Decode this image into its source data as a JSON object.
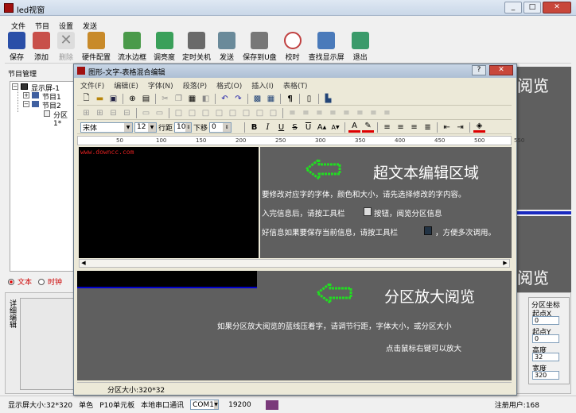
{
  "app": {
    "title": "led视窗"
  },
  "menu": [
    "文件",
    "节目",
    "设置",
    "发送"
  ],
  "toolbar": [
    {
      "label": "保存",
      "icon": "save-icon",
      "color": "#2a4fa8"
    },
    {
      "label": "添加",
      "icon": "add-icon",
      "color": "#c8504a"
    },
    {
      "label": "删除",
      "icon": "delete-icon",
      "color": "#999999"
    },
    {
      "label": "硬件配置",
      "icon": "hardware-config-icon",
      "color": "#c88a2a"
    },
    {
      "label": "流水边框",
      "icon": "border-icon",
      "color": "#4a9a4a"
    },
    {
      "label": "调亮度",
      "icon": "brightness-icon",
      "color": "#3aa05a"
    },
    {
      "label": "定时关机",
      "icon": "timer-shutdown-icon",
      "color": "#6a6a6a"
    },
    {
      "label": "发送",
      "icon": "send-icon",
      "color": "#6a8a9a"
    },
    {
      "label": "保存到U盘",
      "icon": "usb-icon",
      "color": "#777777"
    },
    {
      "label": "校时",
      "icon": "clock-icon",
      "color": "#c04040"
    },
    {
      "label": "查找显示屏",
      "icon": "find-screen-icon",
      "color": "#4a7aba"
    },
    {
      "label": "退出",
      "icon": "exit-icon",
      "color": "#3a9a6a"
    }
  ],
  "tree": {
    "header": "节目管理",
    "screen": "显示屏-1",
    "program1": "节目1",
    "program2": "节目2",
    "zone": "分区1*"
  },
  "left_bottom": {
    "radio_text": "文本",
    "radio_clock": "时钟",
    "vertical_label": "详细编辑"
  },
  "bg_texts": {
    "preview_top": "阅览",
    "preview_bottom": "阅览"
  },
  "right_panel": {
    "title": "分区坐标",
    "fields": [
      {
        "label": "起点X",
        "value": "0"
      },
      {
        "label": "起点Y",
        "value": "0"
      },
      {
        "label": "高度",
        "value": "32"
      },
      {
        "label": "宽度",
        "value": "320"
      }
    ]
  },
  "status": {
    "screen_size": "显示屏大小:32*320",
    "color_mode": "单色",
    "unit": "P10单元板",
    "comm": "本地串口通讯",
    "port": "COM1",
    "baud": "19200",
    "user": "注册用户:168"
  },
  "dialog": {
    "title": "图形-文字-表格混合编辑",
    "menu": [
      "文件(F)",
      "编辑(E)",
      "字体(N)",
      "段落(P)",
      "格式(O)",
      "插入(I)",
      "表格(T)"
    ],
    "font_name": "宋体",
    "font_size": "12",
    "line_spacing_label": "行距",
    "line_spacing": "10",
    "shift_label": "下移",
    "shift": "0",
    "editor_text": "www.downcc.com",
    "status": "分区大小:320*32"
  },
  "annotations": {
    "rich_text_title": "超文本编辑区域",
    "rich_text_line1": "要修改对应字的字体，颜色和大小，请先选择修改的字内容。",
    "rich_text_line2a": "入完信息后，请按工具栏",
    "rich_text_line2b": "按钮，阅览分区信息",
    "rich_text_line3a": "好信息如果要保存当前信息，请按工具栏",
    "rich_text_line3b": "，方便多次调用。",
    "zoom_title": "分区放大阅览",
    "zoom_line1": "如果分区放大阅览的蓝线压着字，请调节行距，字体大小，或分区大小",
    "zoom_line2": "点击鼠标右键可以放大"
  },
  "ruler_ticks": [
    "50",
    "100",
    "150",
    "200",
    "250",
    "300",
    "350",
    "400",
    "450",
    "500",
    "550"
  ],
  "colors": {
    "arrow_green": "#22dd22",
    "editor_bg": "#000000",
    "zoom_blue": "#0000cc",
    "dark_panel": "#5f5f5f"
  }
}
